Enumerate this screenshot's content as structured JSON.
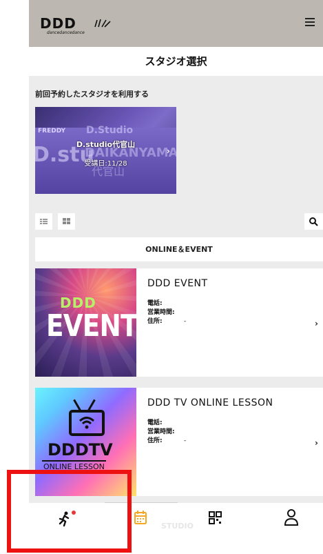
{
  "header": {
    "logo_text": "DDD",
    "logo_sub": "dancedancedance",
    "menu_icon": "hamburger-menu-icon"
  },
  "title": "スタジオ選択",
  "previous": {
    "label": "前回予約したスタジオを利用する",
    "studio_name": "D.studio代官山",
    "date": "受講日:11/28",
    "image_text": {
      "sign": "FREDDY",
      "big": "D.stu",
      "wm1": "D.Studio",
      "wm2": "DAIKANYAMA",
      "wm3": "代官山"
    }
  },
  "toolbar": {
    "list_view_icon": "list-view-icon",
    "grid_view_icon": "grid-view-icon",
    "search_icon": "search-icon"
  },
  "filter": {
    "label": "ONLINE＆EVENT"
  },
  "studios": [
    {
      "name": "DDD EVENT",
      "phone_label": "電話:",
      "hours_label": "営業時間:",
      "address_label": "住所:",
      "address_value": "-",
      "thumb_line1": "DDD",
      "thumb_line2": "EVENT"
    },
    {
      "name": "DDD TV ONLINE LESSON",
      "phone_label": "電話:",
      "hours_label": "営業時間:",
      "address_label": "住所:",
      "address_value": "-",
      "thumb_line1": "DDDTV",
      "thumb_line2": "ONLINE LESSON"
    }
  ],
  "bottom_nav": {
    "items": [
      {
        "icon": "running-person-icon",
        "badge_color": "#e53935"
      },
      {
        "icon": "calendar-icon",
        "color": "#f5a623"
      },
      {
        "icon": "qr-code-icon"
      },
      {
        "icon": "user-profile-icon"
      }
    ],
    "studio_label": "STUDIO"
  },
  "colors": {
    "header_bg": "#bcb8b1",
    "content_bg": "#ececec",
    "accent_calendar": "#f5a623",
    "highlight_border": "#ee1111"
  }
}
